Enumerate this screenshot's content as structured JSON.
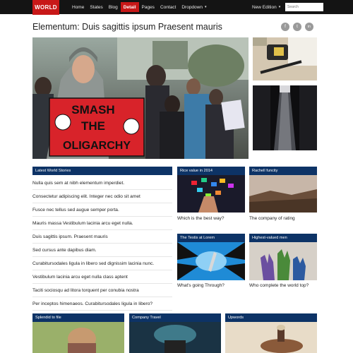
{
  "nav": {
    "logo": "WORLD",
    "items": [
      "Home",
      "States",
      "Blog",
      "Detail",
      "Pages",
      "Contact",
      "Dropdown"
    ],
    "active_index": 3,
    "edition": "New Edition",
    "search_placeholder": "Search"
  },
  "article": {
    "title": "Elementum: Duis sagittis ipsum Praesent mauris",
    "hero_sign": [
      "SMASH",
      "THE",
      "OLIGARCHY"
    ]
  },
  "latest": {
    "header": "Latest World Stories",
    "items": [
      "Nulla quis sem at nibh elementum imperdiet.",
      "Consectetur adipiscing elit. Integer nec odio sit amet",
      "Fusce nec tellus sed augue semper porta.",
      "Mauris massa Vestibulum lacinia arcu eget nulla.",
      "Duis sagittis ipsum. Praesent mauris",
      "Sed cursus ante dapibus diam.",
      "Curabitursodales ligula in libero sed dignissim lacinia nunc.",
      "Vestibulum lacinia arcu eget nulla class aptent",
      "Taciti sociosqu ad litora torquent per conubia nostra",
      "Per inceptos himenaeos. Curabitursodales ligula in libero?"
    ]
  },
  "cards": [
    {
      "header": "Rice value in 2014",
      "caption": "Which is the best way?"
    },
    {
      "header": "Rachell funcity",
      "caption": "The company of rating"
    },
    {
      "header": "The Testis at Lorem",
      "caption": "What's going Through?"
    },
    {
      "header": "Highest-valued men",
      "caption": "Who complete the world top?"
    }
  ],
  "bottom": [
    {
      "header": "Splendid to file"
    },
    {
      "header": "Company Travel"
    },
    {
      "header": "Upwords"
    }
  ],
  "colors": {
    "brand_red": "#c81818",
    "navy": "#0d3366",
    "topbar": "#141414"
  }
}
